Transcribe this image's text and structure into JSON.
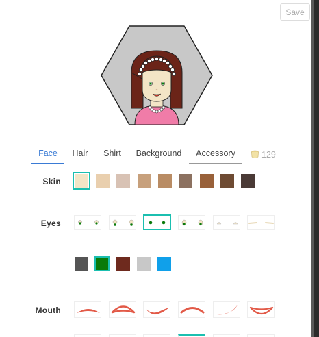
{
  "header": {
    "save_label": "Save"
  },
  "tabs": [
    {
      "label": "Face",
      "active": true
    },
    {
      "label": "Hair",
      "active": false
    },
    {
      "label": "Shirt",
      "active": false
    },
    {
      "label": "Background",
      "active": false
    },
    {
      "label": "Accessory",
      "active": false
    }
  ],
  "coins": {
    "count": "129",
    "icon": "coin-pot-icon"
  },
  "rows": {
    "skin": {
      "label": "Skin",
      "colors": [
        "#f3e5c6",
        "#e9cfae",
        "#d8c2b4",
        "#c7a07c",
        "#b98c64",
        "#8c7160",
        "#99613a",
        "#6e4b33",
        "#4a3a36"
      ],
      "selected_index": 0
    },
    "eyes": {
      "label": "Eyes",
      "styles": [
        "dot-eyes",
        "round-eyes",
        "pupil-eyes",
        "big-eyes",
        "oval-eyes",
        "closed-eyes",
        "line-eyes"
      ],
      "selected_index": 2,
      "colors": [
        "#555555",
        "#0a7a0a",
        "#6e2a1e",
        "#c8c8c8",
        "#10a0ea"
      ],
      "selected_color_index": 1
    },
    "mouth": {
      "label": "Mouth",
      "styles": [
        "frown",
        "open-frown",
        "wave",
        "arch",
        "smirk",
        "grin"
      ],
      "lip_color": "#e25a48"
    }
  },
  "avatar": {
    "background": "#c8c8c8",
    "hair_color": "#6b2418",
    "skin_color": "#f3e5c6",
    "shirt_color": "#f07ca8",
    "eye_color": "#0a7a0a"
  }
}
